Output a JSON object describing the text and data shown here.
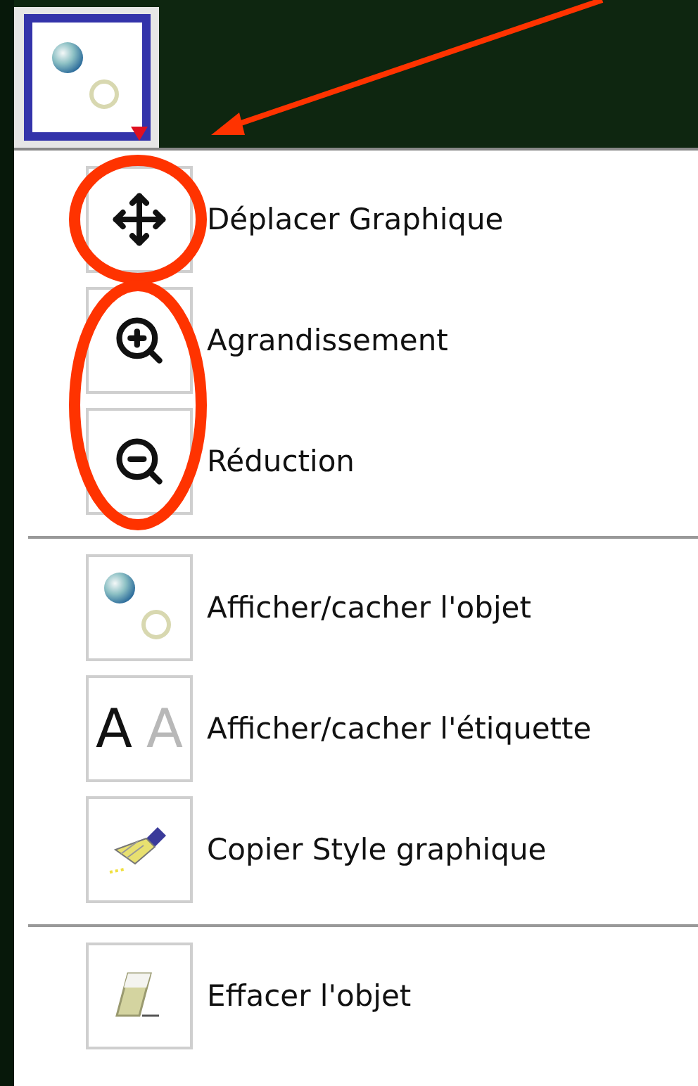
{
  "tool_button": {
    "kind": "show-object",
    "selected": true,
    "dropdown": true
  },
  "annotation_arrow": true,
  "menu": {
    "sections": [
      {
        "items": [
          {
            "kind": "move",
            "label": "Déplacer Graphique",
            "circled": true,
            "in_oval": false
          },
          {
            "kind": "zoom-in",
            "label": "Agrandissement",
            "circled": false,
            "in_oval": true
          },
          {
            "kind": "zoom-out",
            "label": "Réduction",
            "circled": false,
            "in_oval": true
          }
        ]
      },
      {
        "items": [
          {
            "kind": "show-object",
            "label": "Afficher/cacher l'objet",
            "circled": false,
            "in_oval": false
          },
          {
            "kind": "show-label",
            "label": "Afficher/cacher l'étiquette",
            "icon_text": [
              "A",
              "A"
            ],
            "circled": false,
            "in_oval": false
          },
          {
            "kind": "copy-style",
            "label": "Copier Style graphique",
            "circled": false,
            "in_oval": false
          }
        ]
      },
      {
        "items": [
          {
            "kind": "delete",
            "label": "Effacer l'objet",
            "circled": false,
            "in_oval": false
          }
        ]
      }
    ]
  }
}
